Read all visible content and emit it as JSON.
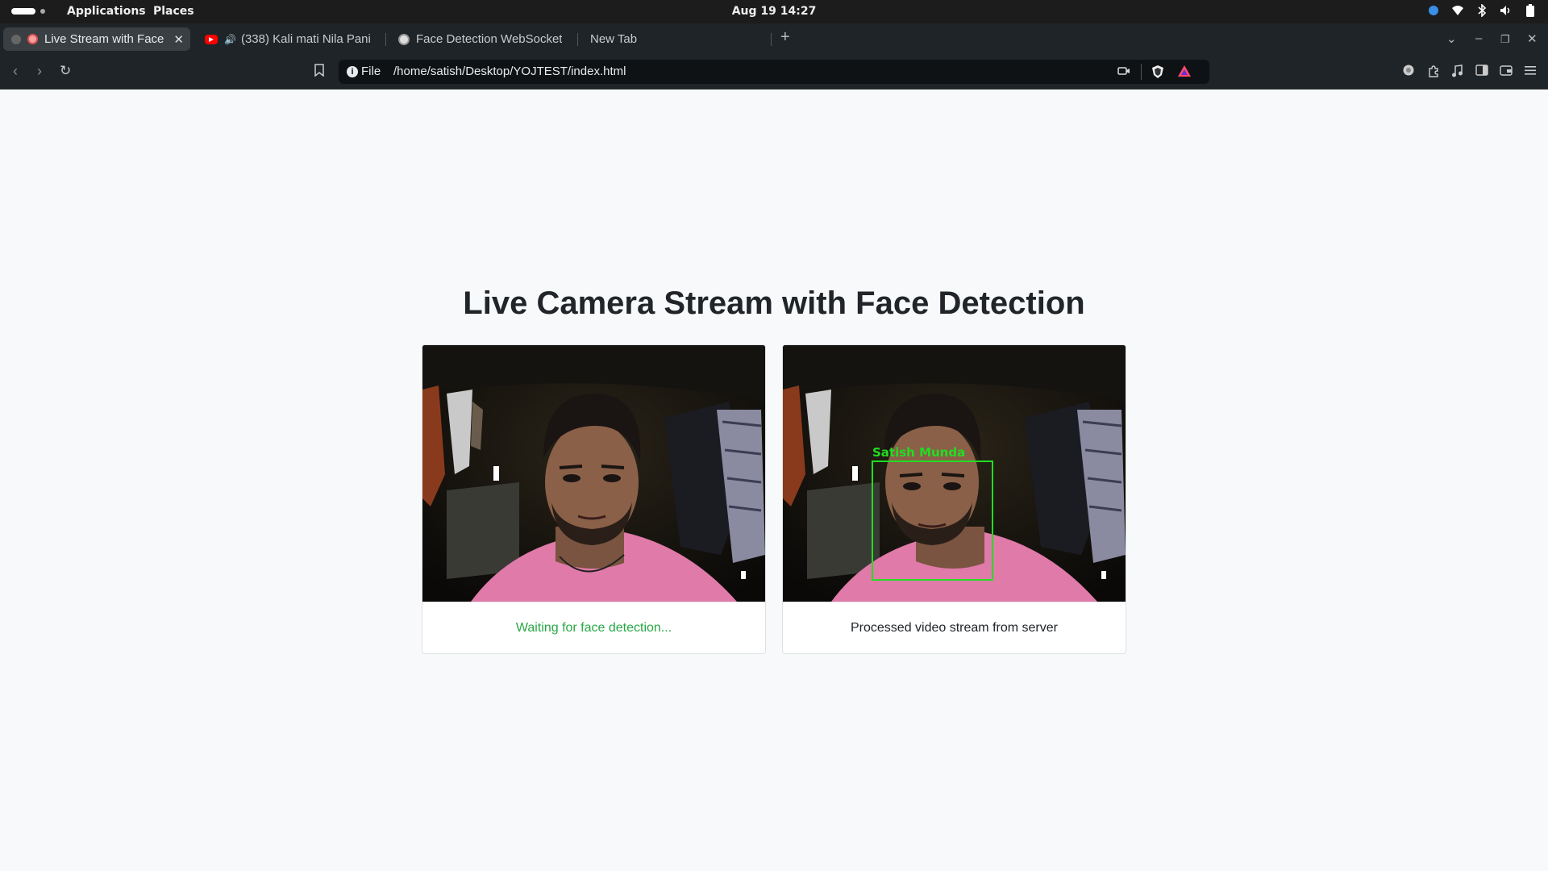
{
  "system": {
    "menu_applications": "Applications",
    "menu_places": "Places",
    "clock": "Aug 19  14:27"
  },
  "tabs": [
    {
      "label": "Live Stream with Face",
      "active": true
    },
    {
      "label": "(338) Kali mati Nila Pani",
      "audio": true
    },
    {
      "label": "Face Detection WebSocket"
    },
    {
      "label": "New Tab"
    }
  ],
  "urlbar": {
    "scheme": "File",
    "url": "/home/satish/Desktop/YOJTEST/index.html"
  },
  "page": {
    "title": "Live Camera Stream with Face Detection",
    "left_caption": "Waiting for face detection...",
    "right_caption": "Processed video stream from server",
    "detection_label": "Satish Munda"
  },
  "colors": {
    "status_green": "#28a745",
    "box_green": "#22dd22",
    "shirt_pink": "#e07aa8"
  },
  "icons": [
    "back-icon",
    "forward-icon",
    "reload-icon",
    "bookmark-icon",
    "camera-icon",
    "brave-shield-icon",
    "brave-rewards-icon",
    "extensions-icon",
    "music-icon",
    "sidebar-icon",
    "wallet-icon",
    "menu-icon",
    "wifi-icon",
    "bluetooth-icon",
    "volume-icon",
    "battery-icon"
  ]
}
